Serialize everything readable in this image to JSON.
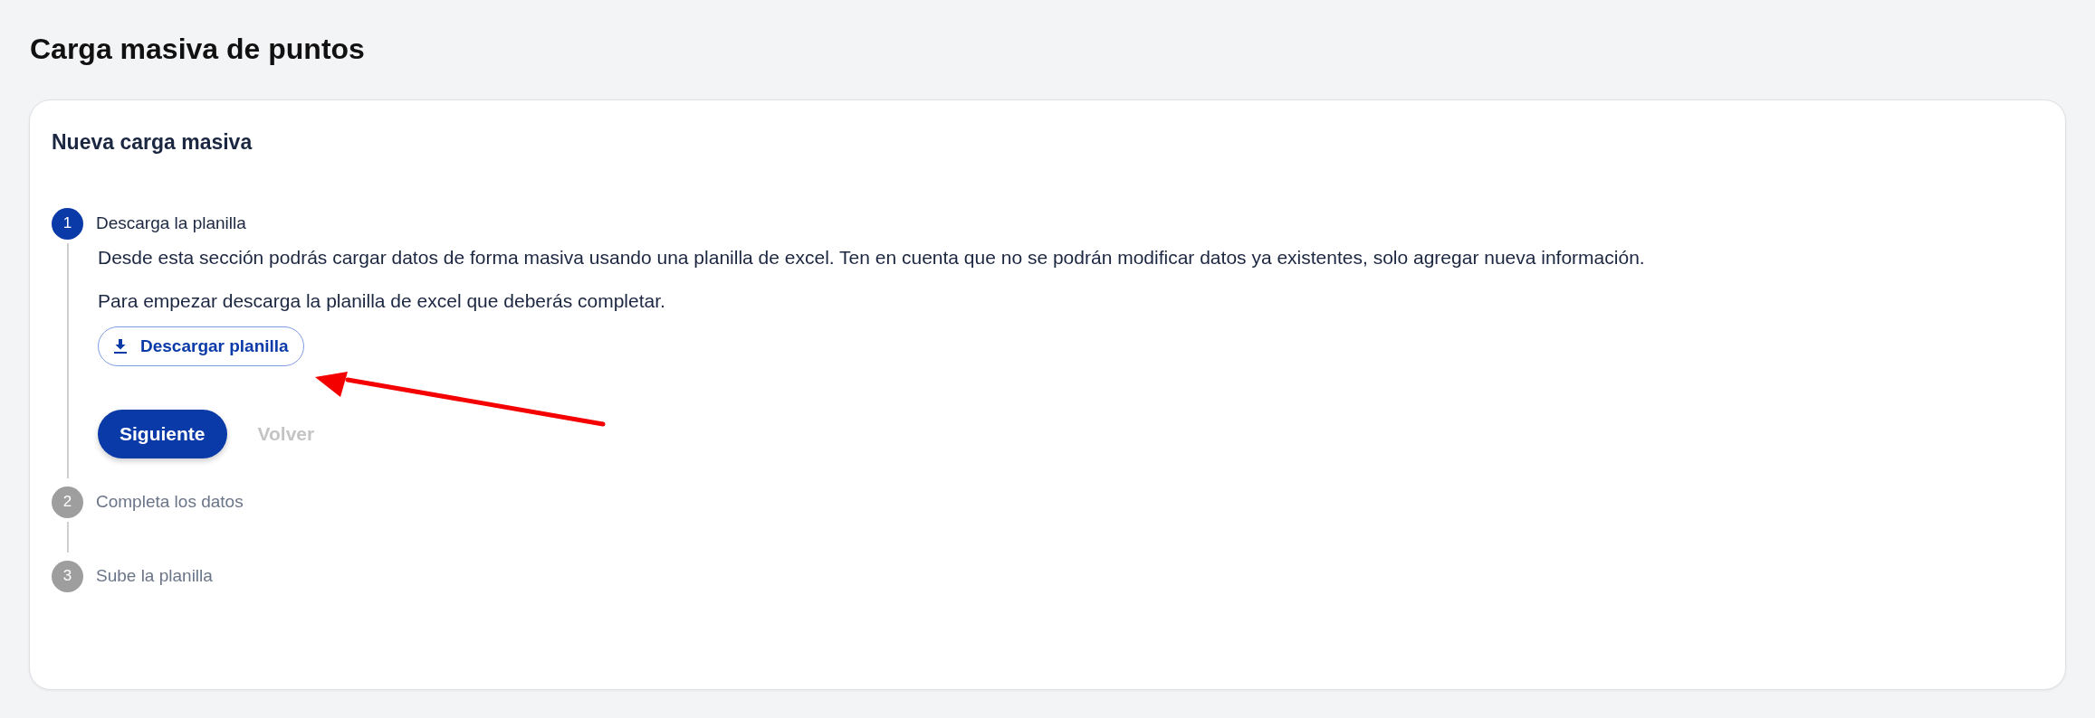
{
  "page": {
    "title": "Carga masiva de puntos"
  },
  "card": {
    "title": "Nueva carga masiva"
  },
  "steps": [
    {
      "number": "1",
      "label": "Descarga la planilla",
      "active": true,
      "paragraphs": [
        "Desde esta sección podrás cargar datos de forma masiva usando una planilla de excel. Ten en cuenta que no se podrán modificar datos ya existentes, solo agregar nueva información.",
        "Para empezar descarga la planilla de excel que deberás completar."
      ],
      "download_button": "Descargar planilla",
      "next_button": "Siguiente",
      "back_button": {
        "label": "Volver",
        "disabled": true
      }
    },
    {
      "number": "2",
      "label": "Completa los datos",
      "active": false
    },
    {
      "number": "3",
      "label": "Sube la planilla",
      "active": false
    }
  ],
  "annotation": {
    "kind": "arrow"
  }
}
